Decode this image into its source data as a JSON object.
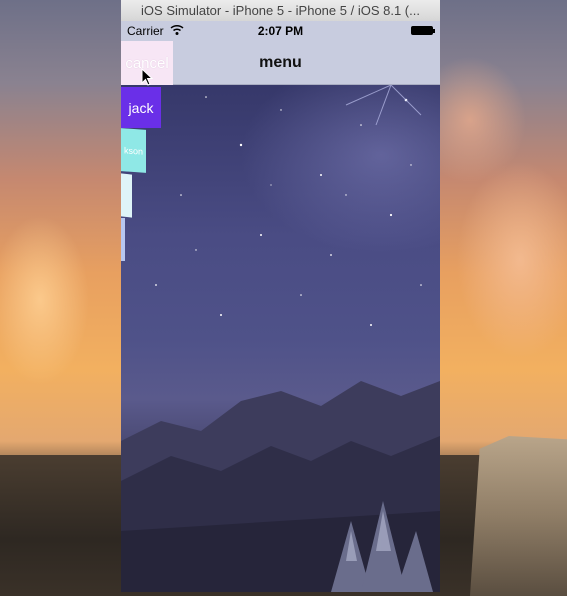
{
  "simulator": {
    "window_title": "iOS Simulator - iPhone 5 - iPhone 5 / iOS 8.1 (..."
  },
  "status_bar": {
    "carrier": "Carrier",
    "time": "2:07 PM",
    "wifi_icon": "wifi-icon",
    "battery_icon": "battery-icon"
  },
  "nav_bar": {
    "title": "menu"
  },
  "menu": {
    "items": [
      {
        "label": "cancel",
        "color": "#f7e6f5"
      },
      {
        "label": "jack",
        "color": "#6a2fe8"
      },
      {
        "label": "kson",
        "color": "#8fe8e6"
      },
      {
        "label": "",
        "color": "#dff4f8"
      },
      {
        "label": "",
        "color": "#b7c6f0"
      }
    ]
  },
  "colors": {
    "nav_bar": "#c8ccdf",
    "background_sky": "#4a4c84"
  },
  "cursor_icon": "arrow-cursor-icon"
}
